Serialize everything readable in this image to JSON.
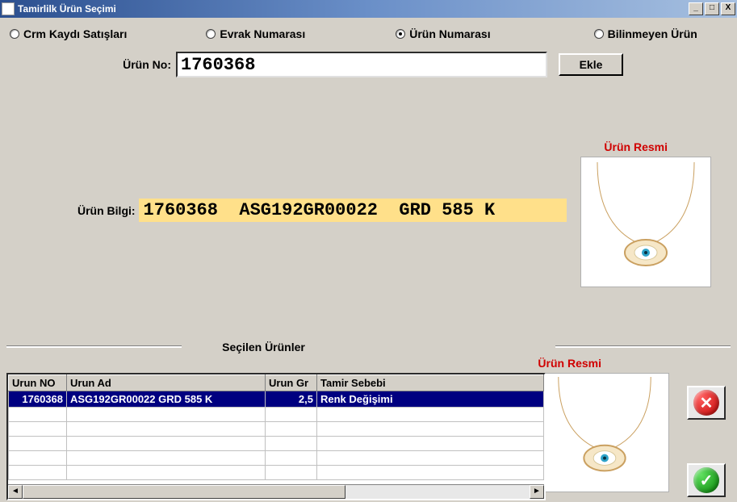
{
  "window": {
    "title": "Tamirlilk Ürün Seçimi",
    "min": "_",
    "max": "□",
    "close": "X"
  },
  "radios": {
    "crm": "Crm Kaydı Satışları",
    "evrak": "Evrak Numarası",
    "urun": "Ürün Numarası",
    "bilinmeyen": "Bilinmeyen Ürün",
    "selected": "urun"
  },
  "urun_no": {
    "label": "Ürün No:",
    "value": "1760368"
  },
  "ekle_label": "Ekle",
  "urun_bilgi": {
    "label": "Ürün Bilgi:",
    "value": "1760368  ASG192GR00022  GRD 585 K"
  },
  "urun_resmi_label": "Ürün Resmi",
  "secilen_label": "Seçilen Ürünler",
  "grid": {
    "cols": {
      "no": "Urun NO",
      "ad": "Urun Ad",
      "gr": "Urun Gr",
      "sebep": "Tamir Sebebi"
    },
    "rows": [
      {
        "no": "1760368",
        "ad": "ASG192GR00022  GRD 585 K",
        "gr": "2,5",
        "sebep": "Renk Değişimi"
      }
    ]
  },
  "icons": {
    "cancel": "✕",
    "ok": "✓"
  }
}
